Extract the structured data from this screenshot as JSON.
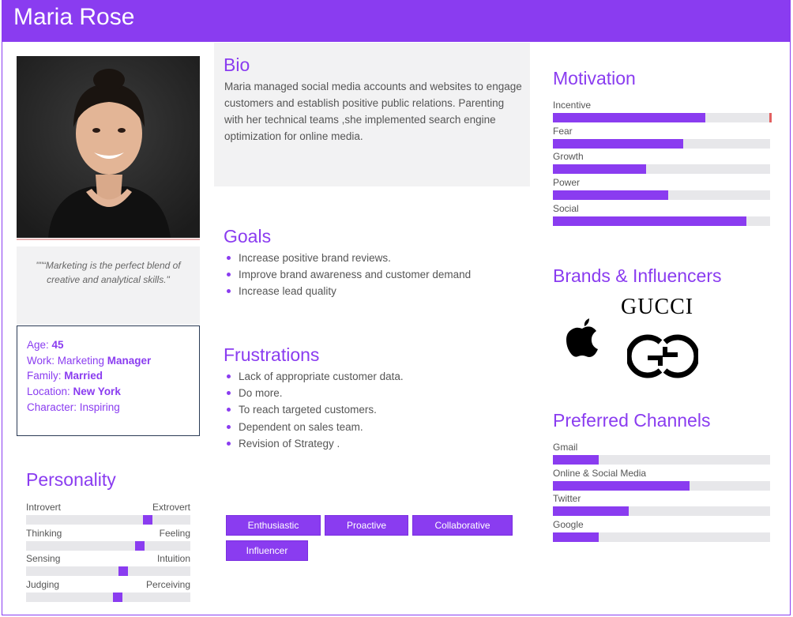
{
  "header": {
    "name": "Maria Rose"
  },
  "quote": "\"\"“Marketing is the perfect blend of creative and analytical skills.\"",
  "info": {
    "age_label": "Age: ",
    "age": "45",
    "work_label": "Work: Marketing ",
    "work": "Manager",
    "family_label": "Family: ",
    "family": "Married",
    "location_label": "Location: ",
    "location": "New York",
    "character": "Character: Inspiring"
  },
  "bio": {
    "title": "Bio",
    "text": "Maria managed social media accounts and websites to engage customers and establish positive public relations. Parenting with her technical teams ,she implemented search engine optimization for online media."
  },
  "goals": {
    "title": "Goals",
    "items": [
      "Increase positive brand reviews.",
      "Improve brand awareness and customer demand",
      "Increase lead quality"
    ]
  },
  "frustrations": {
    "title": "Frustrations",
    "items": [
      "Lack of appropriate customer data.",
      "Do more.",
      "To reach targeted customers.",
      "Dependent on sales team.",
      "Revision of Strategy ."
    ]
  },
  "tags": [
    "Enthusiastic",
    "Proactive",
    "Collaborative",
    "Influencer"
  ],
  "personality": {
    "title": "Personality",
    "scales": [
      {
        "left": "Introvert",
        "right": "Extrovert",
        "position": 0.74
      },
      {
        "left": "Thinking",
        "right": "Feeling",
        "position": 0.69
      },
      {
        "left": "Sensing",
        "right": "Intuition",
        "position": 0.59
      },
      {
        "left": "Judging",
        "right": "Perceiving",
        "position": 0.56
      }
    ]
  },
  "motivation": {
    "title": "Motivation",
    "bars": [
      {
        "label": "Incentive",
        "value": 0.7
      },
      {
        "label": "Fear",
        "value": 0.6
      },
      {
        "label": "Growth",
        "value": 0.43
      },
      {
        "label": "Power",
        "value": 0.53
      },
      {
        "label": "Social",
        "value": 0.89
      }
    ]
  },
  "brands": {
    "title": "Brands & Influencers",
    "gucci_wordmark": "GUCCI"
  },
  "channels": {
    "title": "Preferred Channels",
    "bars": [
      {
        "label": "Gmail",
        "value": 0.21
      },
      {
        "label": "Online & Social Media",
        "value": 0.63
      },
      {
        "label": "Twitter",
        "value": 0.35
      },
      {
        "label": "Google",
        "value": 0.21
      }
    ]
  },
  "colors": {
    "accent": "#8a3cf0",
    "panel": "#f2f2f3",
    "track": "#e7e7ea"
  }
}
